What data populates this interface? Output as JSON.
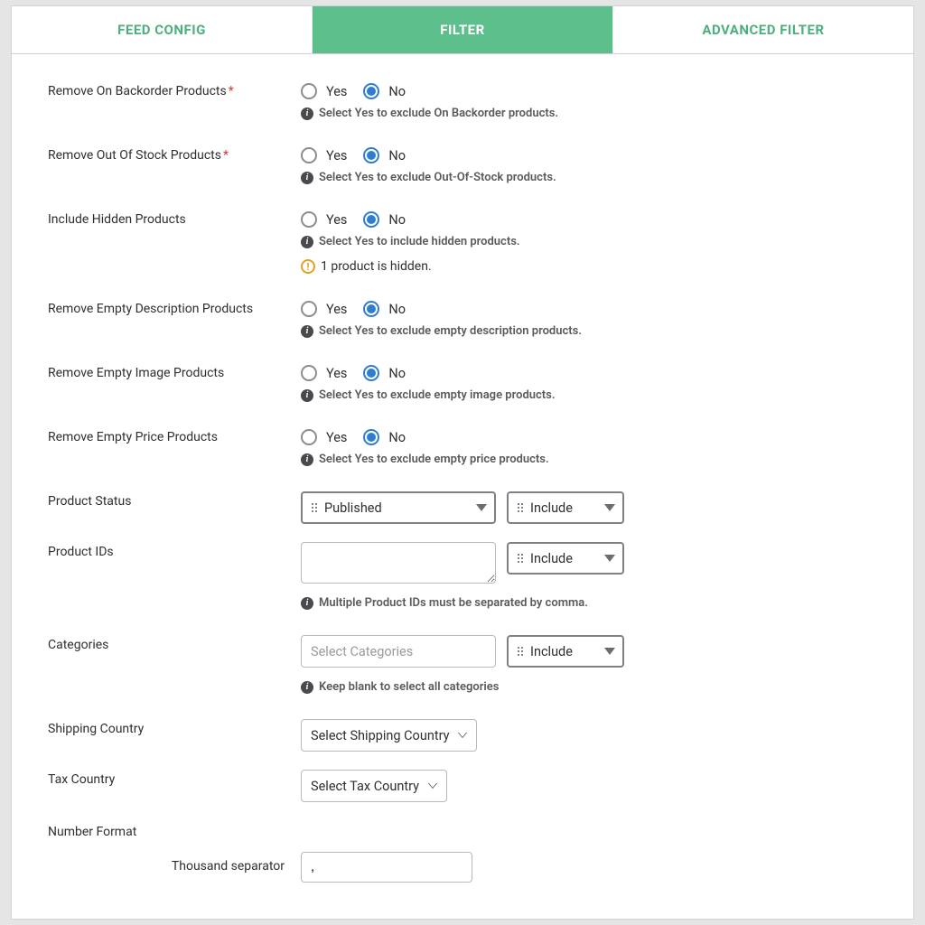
{
  "tabs": {
    "feed_config": "FEED CONFIG",
    "filter": "FILTER",
    "advanced_filter": "ADVANCED FILTER"
  },
  "opts": {
    "yes": "Yes",
    "no": "No"
  },
  "include_opts": {
    "include": "Include"
  },
  "rows": {
    "backorder": {
      "label": "Remove On Backorder Products",
      "selected": "no",
      "hint": "Select Yes to exclude On Backorder products."
    },
    "outofstock": {
      "label": "Remove Out Of Stock Products",
      "selected": "no",
      "hint": "Select Yes to exclude Out-Of-Stock products."
    },
    "hidden": {
      "label": "Include Hidden Products",
      "selected": "no",
      "hint": "Select Yes to include hidden products.",
      "warn": "1 product is hidden."
    },
    "empty_desc": {
      "label": "Remove Empty Description Products",
      "selected": "no",
      "hint": "Select Yes to exclude empty description products."
    },
    "empty_image": {
      "label": "Remove Empty Image Products",
      "selected": "no",
      "hint": "Select Yes to exclude empty image products."
    },
    "empty_price": {
      "label": "Remove Empty Price Products",
      "selected": "no",
      "hint": "Select Yes to exclude empty price products."
    }
  },
  "product_status": {
    "label": "Product Status",
    "value": "Published",
    "mode": "Include"
  },
  "product_ids": {
    "label": "Product IDs",
    "value": "",
    "mode": "Include",
    "hint": "Multiple Product IDs must be separated by comma."
  },
  "categories": {
    "label": "Categories",
    "placeholder": "Select Categories",
    "mode": "Include",
    "hint": "Keep blank to select all categories"
  },
  "shipping_country": {
    "label": "Shipping Country",
    "placeholder": "Select Shipping Country"
  },
  "tax_country": {
    "label": "Tax Country",
    "placeholder": "Select Tax Country"
  },
  "number_format": {
    "label": "Number Format",
    "thousand_label": "Thousand separator",
    "thousand_value": ","
  }
}
